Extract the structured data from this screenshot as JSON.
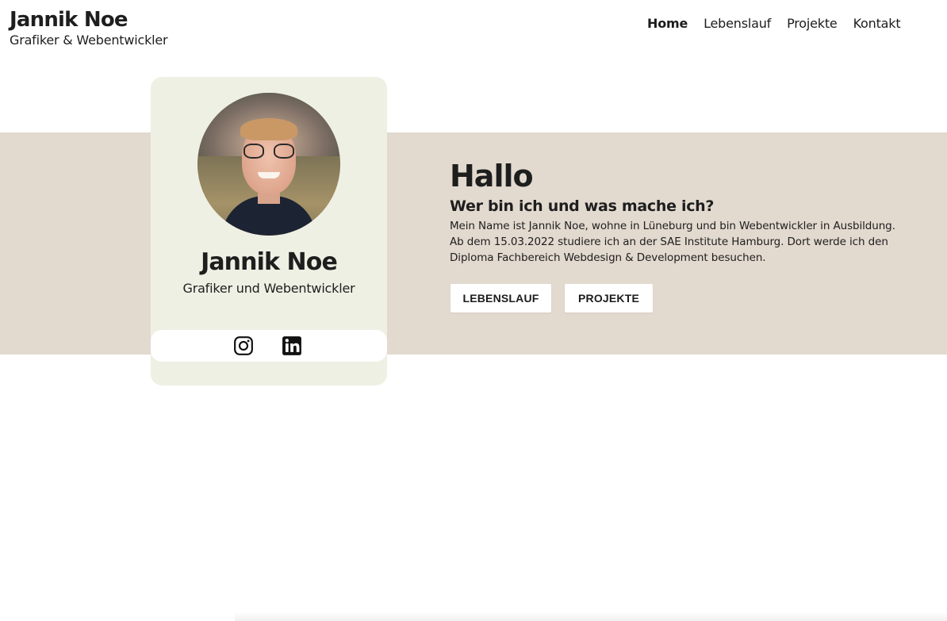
{
  "header": {
    "brand_name": "Jannik Noe",
    "brand_sub": "Grafiker & Webentwickler",
    "nav": [
      {
        "label": "Home",
        "active": true
      },
      {
        "label": "Lebenslauf",
        "active": false
      },
      {
        "label": "Projekte",
        "active": false
      },
      {
        "label": "Kontakt",
        "active": false
      }
    ]
  },
  "profile_card": {
    "name": "Jannik Noe",
    "role": "Grafiker und Webentwickler",
    "social": [
      {
        "icon": "instagram-icon"
      },
      {
        "icon": "linkedin-icon"
      }
    ]
  },
  "intro": {
    "heading": "Hallo",
    "subheading": "Wer bin ich und was mache ich?",
    "line1": "Mein Name ist Jannik Noe, wohne in Lüneburg und bin Webentwickler in Ausbildung.",
    "line2": "Ab dem 15.03.2022 studiere ich an der SAE Institute Hamburg. Dort werde ich den",
    "line3": "Diploma Fachbereich Webdesign & Development besuchen.",
    "buttons": {
      "lebenslauf": "LEBENSLAUF",
      "projekte": "PROJEKTE"
    }
  },
  "colors": {
    "band": "#e2d9cf",
    "card": "#eff0e4",
    "text": "#1e1e1e",
    "white": "#ffffff"
  }
}
